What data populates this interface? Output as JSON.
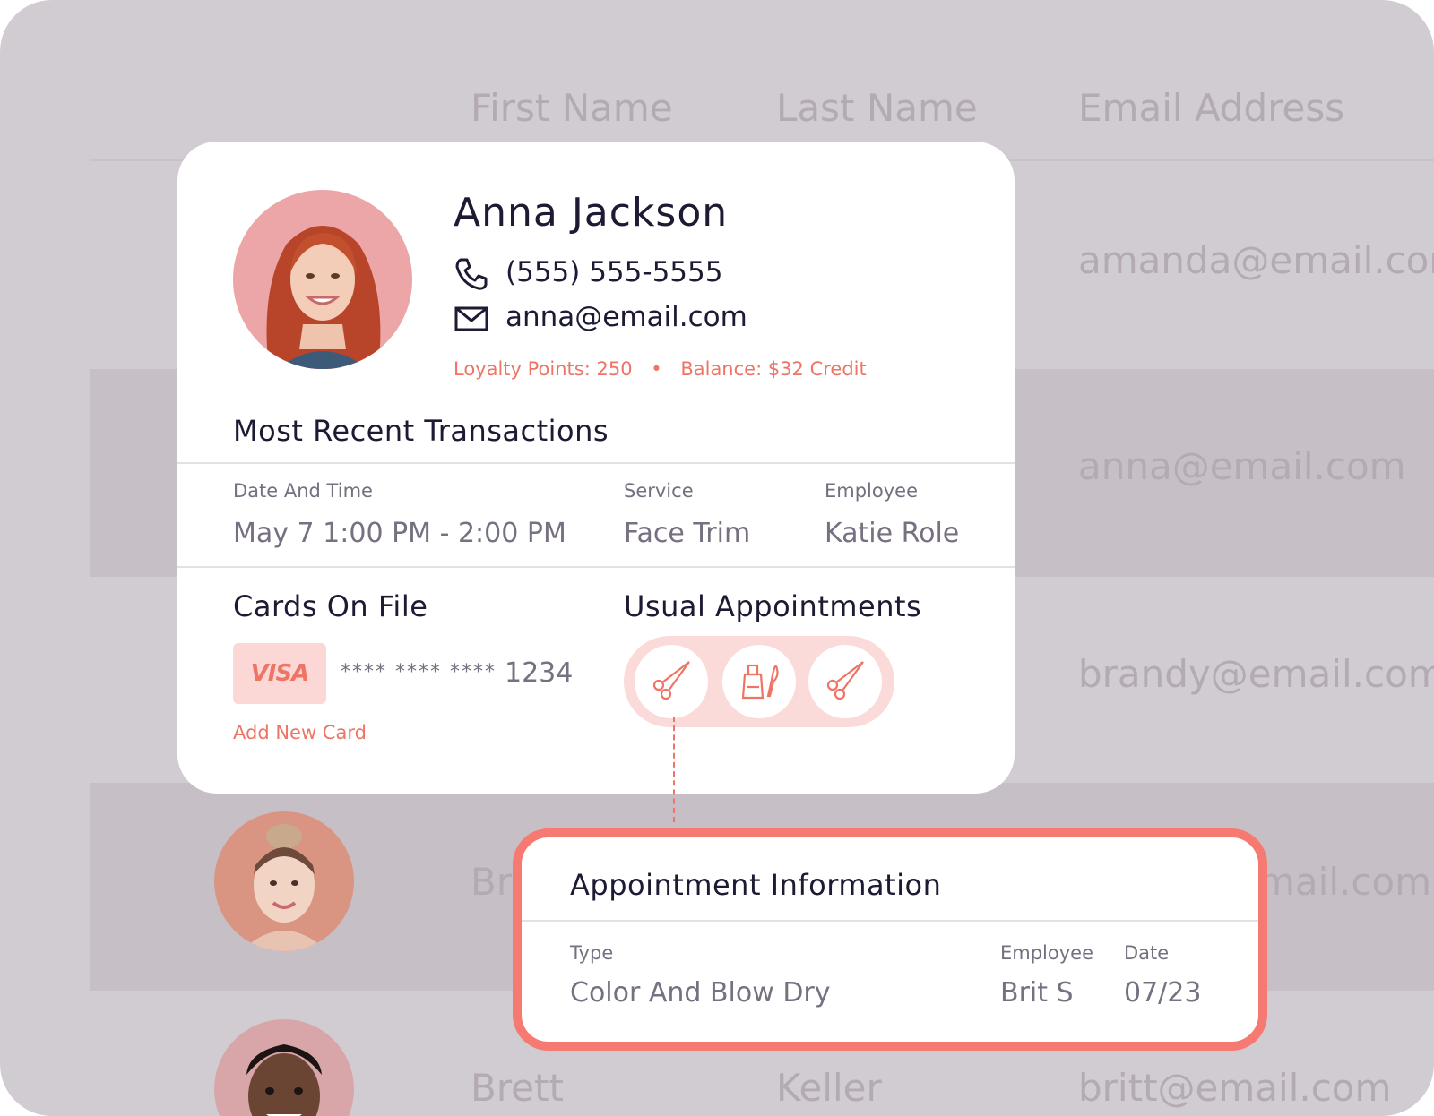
{
  "background_table": {
    "columns": [
      "First Name",
      "Last Name",
      "Email Address"
    ],
    "emails": [
      "amanda@email.com",
      "anna@email.com",
      "brandy@email.com",
      "mail.com",
      "britt@email.com"
    ],
    "partial_first_name": "Br",
    "last_row": {
      "first": "Brett",
      "last": "Keller"
    }
  },
  "customer": {
    "name": "Anna Jackson",
    "phone": "(555) 555-5555",
    "email": "anna@email.com",
    "loyalty": "Loyalty Points: 250",
    "separator": "•",
    "balance": "Balance: $32 Credit"
  },
  "transactions": {
    "title": "Most Recent Transactions",
    "headers": [
      "Date And Time",
      "Service",
      "Employee"
    ],
    "row": [
      "May 7 1:00 PM - 2:00 PM",
      "Face Trim",
      "Katie Role"
    ]
  },
  "cards": {
    "title": "Cards On File",
    "brand": "VISA",
    "masked_number": "**** **** **** ",
    "last4": "1234",
    "add_label": "Add New Card"
  },
  "usual_appointments": {
    "title": "Usual Appointments",
    "icons": [
      "scissors-icon",
      "nail-polish-icon",
      "scissors-icon"
    ]
  },
  "appointment_info": {
    "title": "Appointment Information",
    "headers": [
      "Type",
      "Employee",
      "Date"
    ],
    "values": [
      "Color And Blow Dry",
      "Brit S",
      "07/23"
    ]
  },
  "colors": {
    "accent": "#ee7566",
    "border_accent": "#f67a71",
    "pill": "#fbdbd9",
    "text_dark": "#1d1a33",
    "background": "#d1ccd1"
  }
}
